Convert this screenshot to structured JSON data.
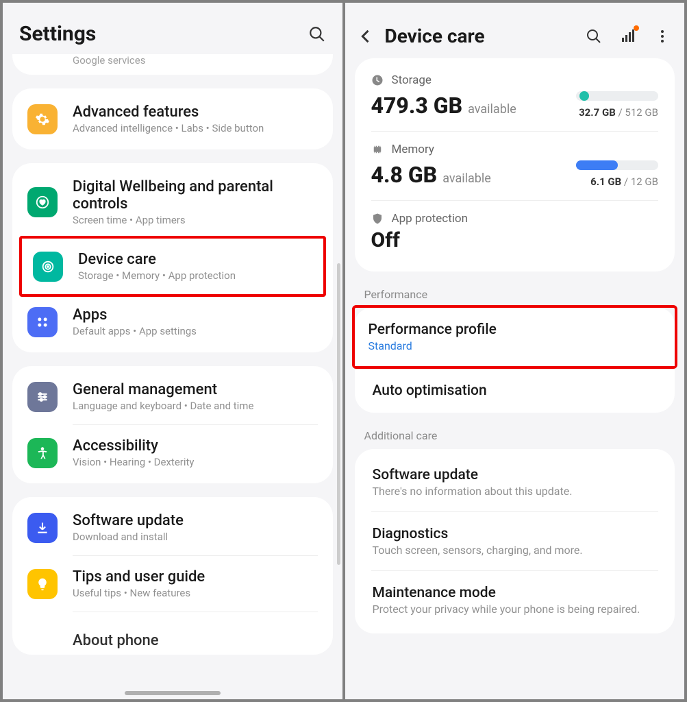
{
  "left": {
    "header_title": "Settings",
    "truncated_top": "Google services",
    "group1": {
      "advanced": {
        "title": "Advanced features",
        "sub": "Advanced intelligence  •  Labs  •  Side button"
      }
    },
    "group2": {
      "wellbeing": {
        "title": "Digital Wellbeing and parental controls",
        "sub": "Screen time  •  App timers"
      },
      "device_care": {
        "title": "Device care",
        "sub": "Storage  •  Memory  •  App protection"
      },
      "apps": {
        "title": "Apps",
        "sub": "Default apps  •  App settings"
      }
    },
    "group3": {
      "general": {
        "title": "General management",
        "sub": "Language and keyboard  •  Date and time"
      },
      "accessibility": {
        "title": "Accessibility",
        "sub": "Vision  •  Hearing  •  Dexterity"
      }
    },
    "group4": {
      "software": {
        "title": "Software update",
        "sub": "Download and install"
      },
      "tips": {
        "title": "Tips and user guide",
        "sub": "Useful tips  •  New features"
      },
      "about": {
        "title": "About phone"
      }
    }
  },
  "right": {
    "header_title": "Device care",
    "storage": {
      "label": "Storage",
      "value": "479.3 GB",
      "suffix": "available",
      "used": "32.7 GB",
      "total": "512 GB",
      "fill_pct": 6,
      "color": "#1fbfa9"
    },
    "memory": {
      "label": "Memory",
      "value": "4.8 GB",
      "suffix": "available",
      "used": "6.1 GB",
      "total": "12 GB",
      "fill_pct": 51,
      "color": "#3d7df5"
    },
    "app_protection": {
      "label": "App protection",
      "value": "Off"
    },
    "section_performance": "Performance",
    "perf_profile": {
      "title": "Performance profile",
      "sub": "Standard"
    },
    "auto_opt": {
      "title": "Auto optimisation"
    },
    "section_additional": "Additional care",
    "software_update": {
      "title": "Software update",
      "sub": "There's no information about this update."
    },
    "diagnostics": {
      "title": "Diagnostics",
      "sub": "Touch screen, sensors, charging, and more."
    },
    "maintenance": {
      "title": "Maintenance mode",
      "sub": "Protect your privacy while your phone is being repaired."
    }
  }
}
